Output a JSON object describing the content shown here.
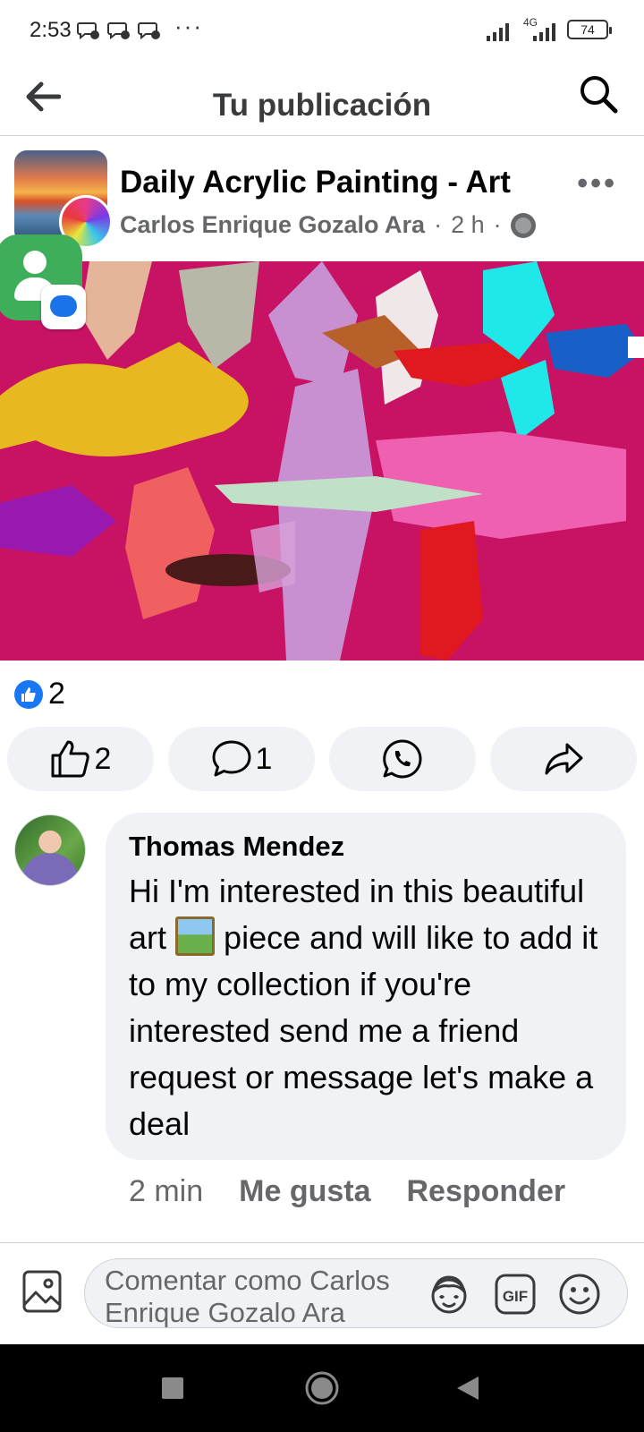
{
  "status_bar": {
    "time": "2:53",
    "more_dots": "···",
    "network": "4G",
    "battery": "74"
  },
  "header": {
    "title": "Tu publicación"
  },
  "post": {
    "group_name": "Daily Acrylic Painting - Art",
    "author": "Carlos Enrique Gozalo Ara",
    "time": "2 h",
    "separator": "·",
    "more": "•••"
  },
  "reactions": {
    "count": "2"
  },
  "actions": {
    "like_count": "2",
    "comment_count": "1"
  },
  "comment": {
    "author": "Thomas Mendez",
    "text_before_emoji": "Hi I'm interested in this beautiful art",
    "text_after_emoji": "piece and will like to add it to my collection if you're interested send me a friend request or message let's make a deal",
    "time": "2 min",
    "like_label": "Me gusta",
    "reply_label": "Responder"
  },
  "composer": {
    "placeholder": "Comentar como Carlos Enrique Gozalo Ara"
  },
  "icons": {
    "back": "arrow-left-icon",
    "search": "search-icon",
    "like": "thumbs-up-icon",
    "comment": "comment-bubble-icon",
    "whatsapp": "whatsapp-icon",
    "share": "share-arrow-icon",
    "photo": "photo-icon",
    "avatar_sticker": "avatar-sticker-icon",
    "gif": "gif-icon",
    "emoji": "emoji-icon"
  },
  "colors": {
    "facebook_blue": "#1877f2",
    "secondary_text": "#65676b",
    "bubble_bg": "#f0f2f5",
    "painting_bg": "#c81264"
  }
}
